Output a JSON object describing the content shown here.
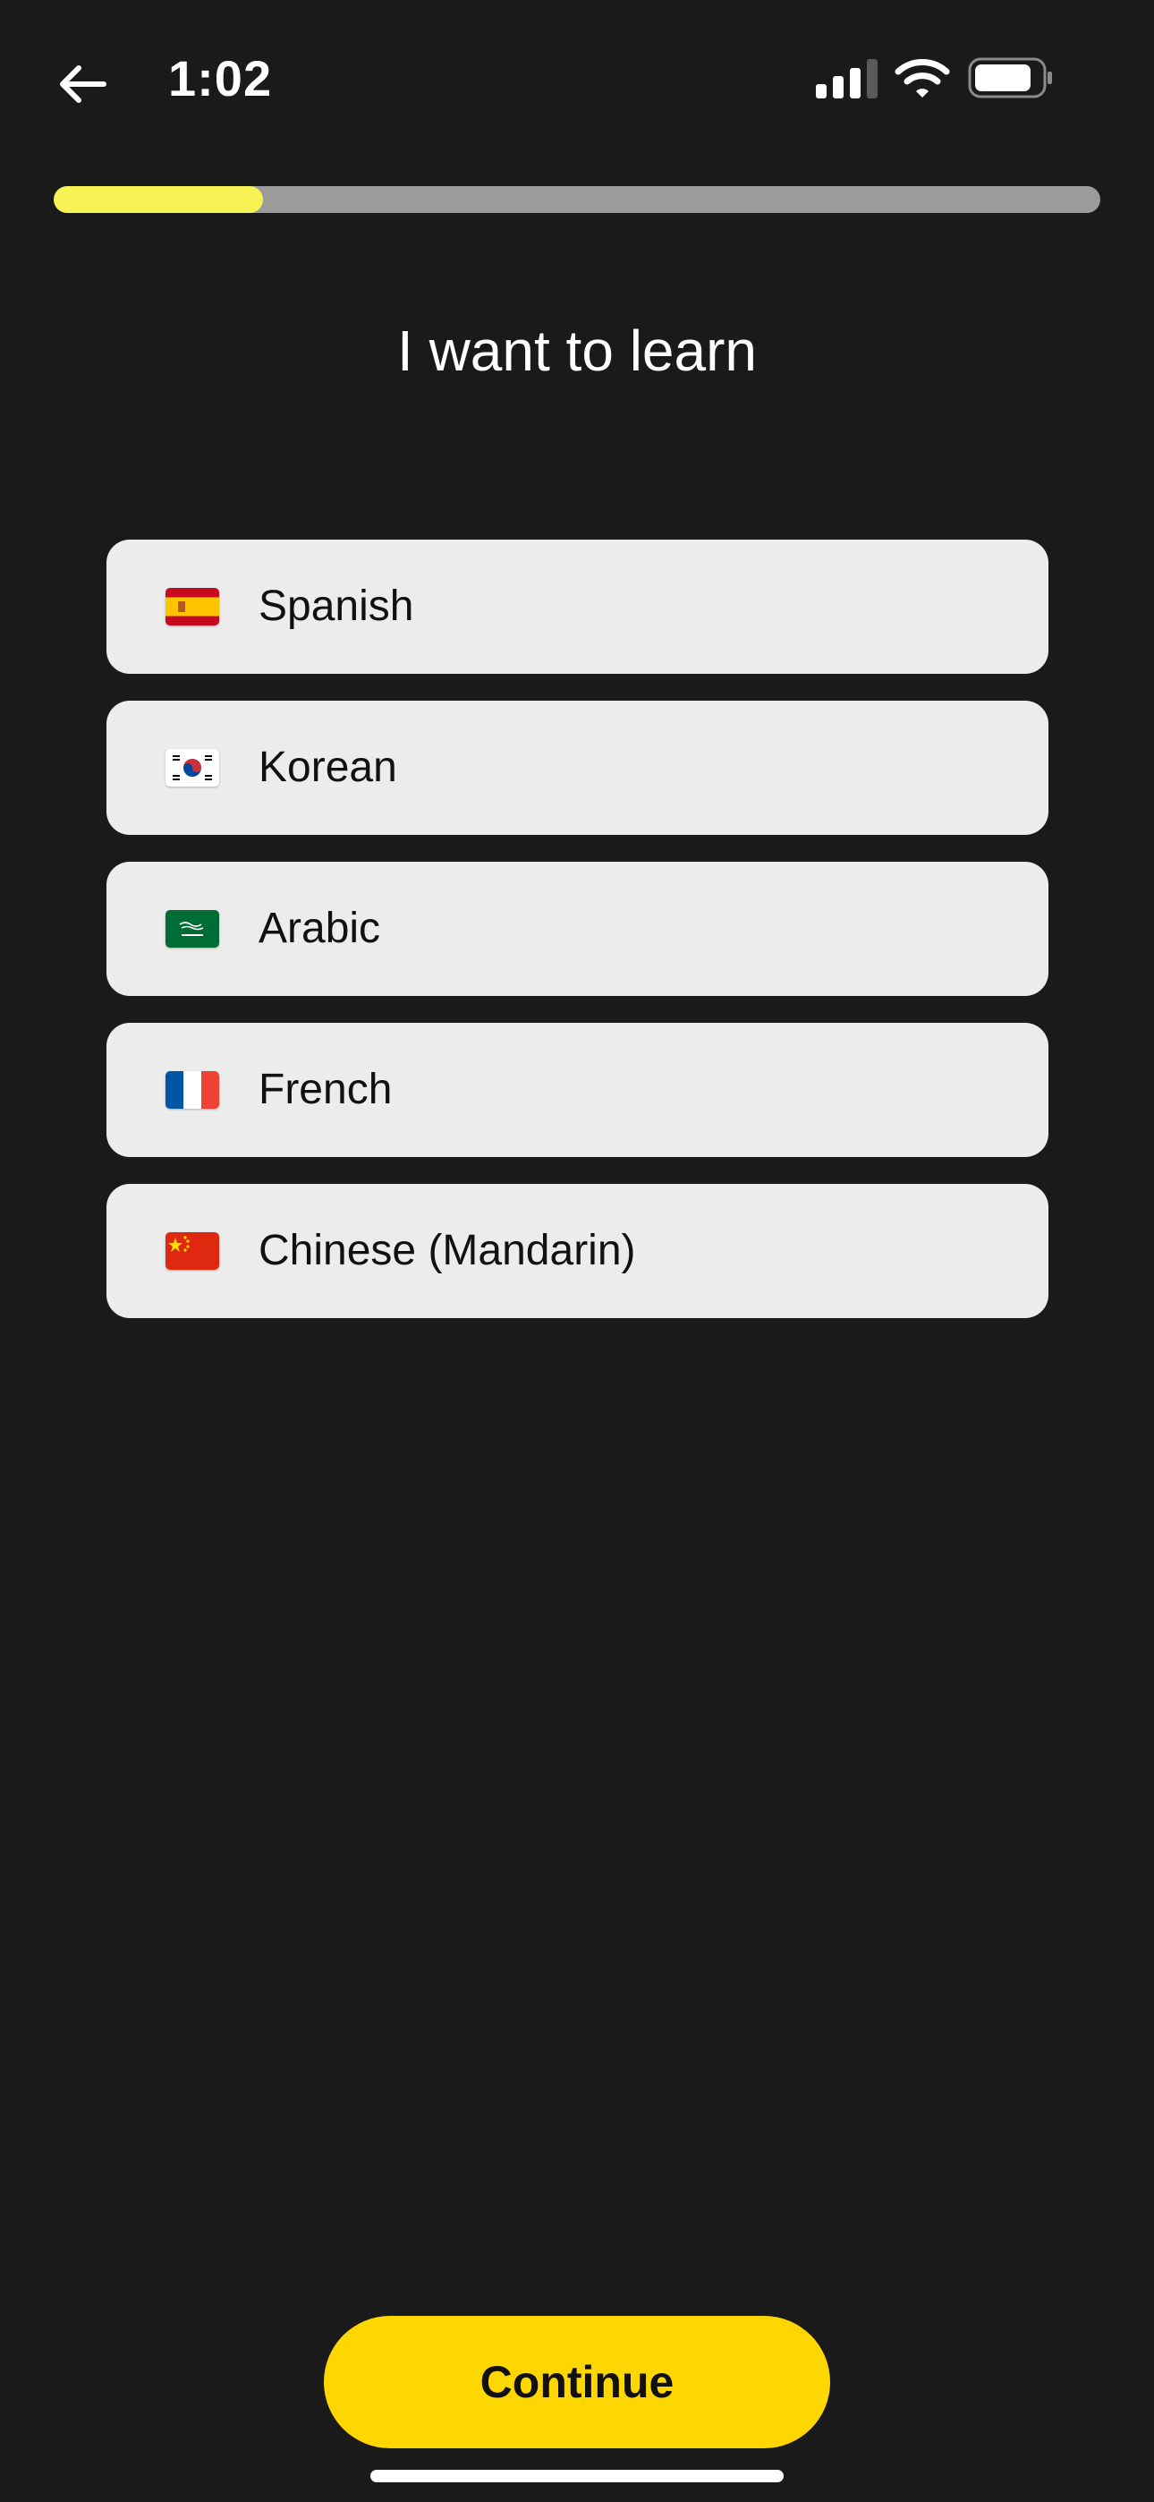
{
  "status_bar": {
    "time": "1:02",
    "icons": [
      "back-arrow-icon",
      "signal-icon",
      "wifi-icon",
      "battery-icon"
    ]
  },
  "progress": {
    "fraction": 0.2,
    "fill_color": "#f8f354",
    "track_color": "#9b9b9b"
  },
  "title": "I want to learn",
  "options": [
    {
      "label": "Spanish",
      "flag": "spain-flag-icon"
    },
    {
      "label": "Korean",
      "flag": "south-korea-flag-icon"
    },
    {
      "label": "Arabic",
      "flag": "saudi-arabia-flag-icon"
    },
    {
      "label": "French",
      "flag": "france-flag-icon"
    },
    {
      "label": "Chinese (Mandarin)",
      "flag": "china-flag-icon"
    }
  ],
  "continue_button": {
    "label": "Continue",
    "color": "#ffd700"
  },
  "colors": {
    "background": "#1a1a1a",
    "option_background": "#ececec"
  }
}
